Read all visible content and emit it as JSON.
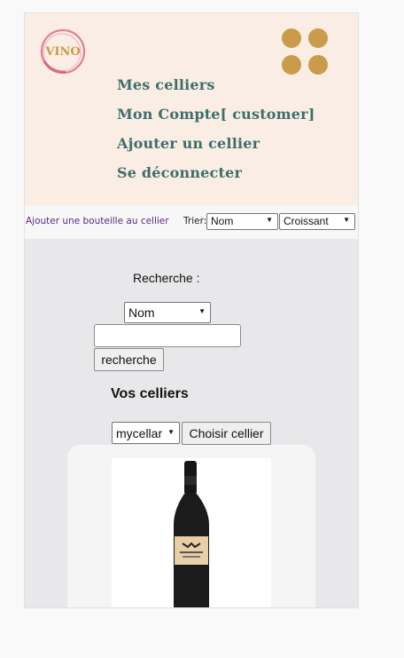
{
  "logo": {
    "text": "VINO"
  },
  "nav": {
    "items": [
      "Mes celliers",
      "Mon Compte[ customer]",
      "Ajouter un cellier",
      "Se déconnecter"
    ]
  },
  "toolbar": {
    "add_bottle_link": "Ajouter une bouteille au cellier",
    "sort_label": "Trier:",
    "sort_field": "Nom",
    "sort_order": "Croissant"
  },
  "search": {
    "label": "Recherche :",
    "field": "Nom",
    "input_value": "",
    "button": "recherche"
  },
  "cellars": {
    "title": "Vos celliers",
    "selected": "mycellar",
    "button": "Choisir cellier"
  },
  "colors": {
    "header_bg": "#faede3",
    "nav_text": "#3d6e6b",
    "menu_dots": "#c99b4a",
    "link": "#5b2a86"
  }
}
